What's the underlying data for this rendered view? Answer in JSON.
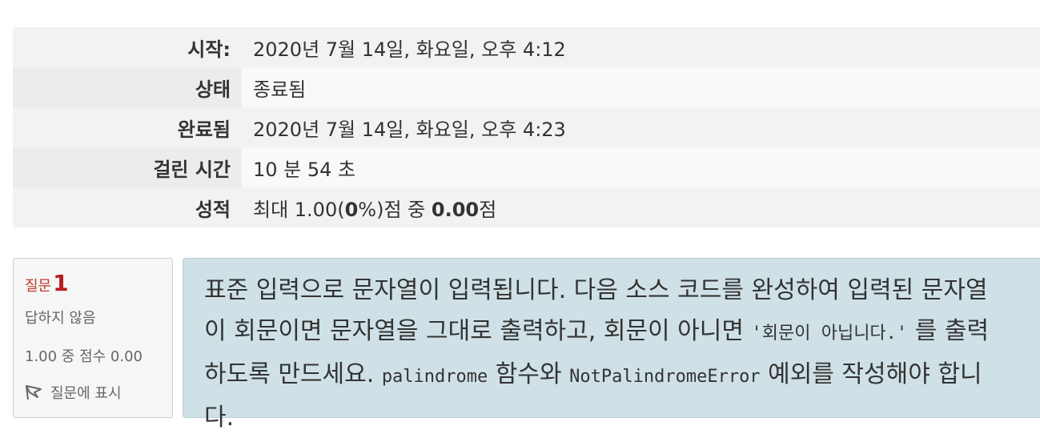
{
  "summary": {
    "rows": [
      {
        "label": "시작:",
        "value": "2020년 7월 14일, 화요일, 오후 4:12"
      },
      {
        "label": "상태",
        "value": "종료됨"
      },
      {
        "label": "완료됨",
        "value": "2020년 7월 14일, 화요일, 오후 4:23"
      },
      {
        "label": "걸린 시간",
        "value": "10 분 54 초"
      }
    ],
    "grade": {
      "label": "성적",
      "prefix": "최대 1.00(",
      "percent": "0",
      "middle": "%)점 중 ",
      "score": "0.00",
      "suffix": "점"
    }
  },
  "question": {
    "label": "질문",
    "number": "1",
    "state": "답하지 않음",
    "grade": "1.00 중 점수 0.00",
    "flag_label": "질문에 표시",
    "text": {
      "part1": "표준 입력으로 문자열이 입력됩니다. 다음 소스 코드를 완성하여 입력된 문자열이 회문이면 문자열을 그대로 출력하고, 회문이 아니면 ",
      "code1": "'회문이 아닙니다.'",
      "part2": " 를 출력하도록 만드세요. ",
      "code2": "palindrome",
      "part3": " 함수와 ",
      "code3": "NotPalindromeError",
      "part4": " 예외를 작성해야 합니다."
    }
  }
}
